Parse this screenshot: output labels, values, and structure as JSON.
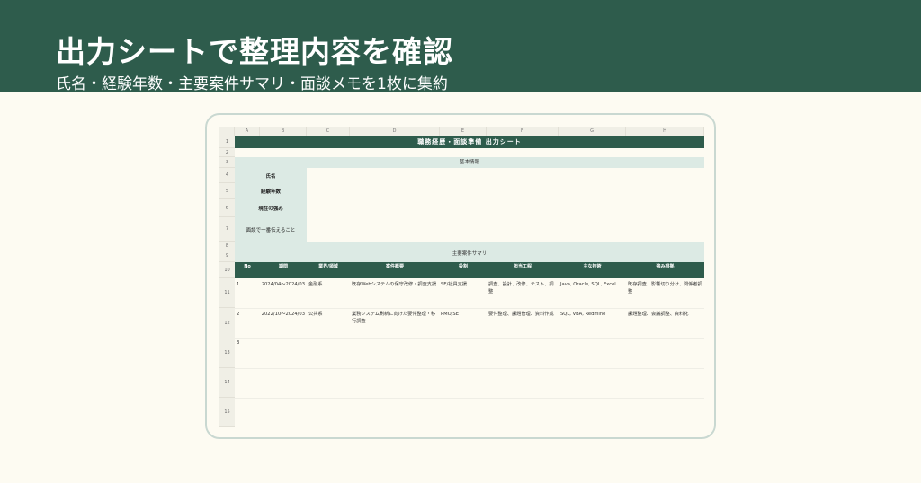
{
  "hero": {
    "title": "出力シートで整理内容を確認",
    "subtitle": "氏名・経験年数・主要案件サマリ・面談メモを1枚に集約"
  },
  "sheet": {
    "column_headers": [
      "A",
      "B",
      "C",
      "D",
      "E",
      "F",
      "G",
      "H"
    ],
    "row_numbers": [
      "1",
      "2",
      "3",
      "4",
      "5",
      "6",
      "7",
      "8",
      "9",
      "10",
      "11",
      "12",
      "13",
      "14",
      "15"
    ],
    "title": "職務経歴・面談準備 出力シート",
    "basic_section": "基本情報",
    "labels": {
      "name": "氏名",
      "years": "経験年数",
      "strength": "現在の強み",
      "message": "面談で一番伝えること"
    },
    "summary_section": "主要案件サマリ",
    "table_headers": [
      "No",
      "期間",
      "業界/領域",
      "案件概要",
      "役割",
      "担当工程",
      "主な技術",
      "強み根拠"
    ],
    "rows": [
      {
        "no": "1",
        "period": "2024/04〜2024/03",
        "industry": "金融系",
        "summary": "既存Webシステムの保守改修・調査支援",
        "role": "SE/社員支援",
        "process": "調査、設計、改修、テスト、調整",
        "tech": "Java, Oracle, SQL, Excel",
        "evidence": "既存調査、影響切り分け、関係者調整"
      },
      {
        "no": "2",
        "period": "2022/10〜2024/03",
        "industry": "公共系",
        "summary": "業務システム刷新に向けた要件整理・移行調査",
        "role": "PMO/SE",
        "process": "要件整理、課題管理、資料作成",
        "tech": "SQL, VBA, Redmine",
        "evidence": "課題整理、会議調整、資料化"
      },
      {
        "no": "3",
        "period": "",
        "industry": "",
        "summary": "",
        "role": "",
        "process": "",
        "tech": "",
        "evidence": ""
      }
    ]
  },
  "colors": {
    "brand": "#2e5c4c",
    "section_fill": "#dceae4",
    "paper": "#fdfbf2"
  }
}
